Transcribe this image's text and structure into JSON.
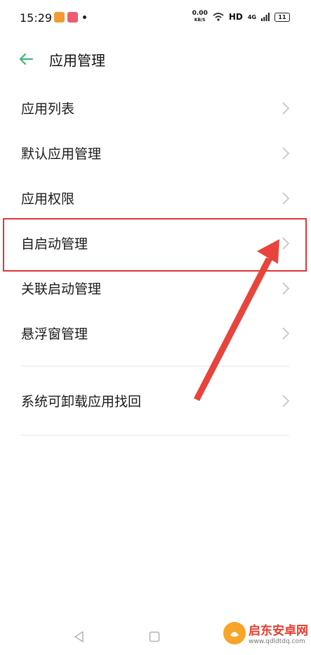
{
  "status": {
    "time": "15:29",
    "net_speed": "0.00",
    "net_unit": "KB/S",
    "hd": "HD",
    "network": "4G",
    "battery": "11"
  },
  "header": {
    "title": "应用管理"
  },
  "menu": {
    "items": [
      {
        "label": "应用列表"
      },
      {
        "label": "默认应用管理"
      },
      {
        "label": "应用权限"
      },
      {
        "label": "自启动管理"
      },
      {
        "label": "关联启动管理"
      },
      {
        "label": "悬浮窗管理"
      }
    ],
    "extra": {
      "label": "系统可卸载应用找回"
    }
  },
  "watermark": {
    "title": "启东安卓网",
    "url": "www.qdldtdq.com"
  },
  "colors": {
    "accent": "#2eb872",
    "highlight": "#e0353a"
  }
}
